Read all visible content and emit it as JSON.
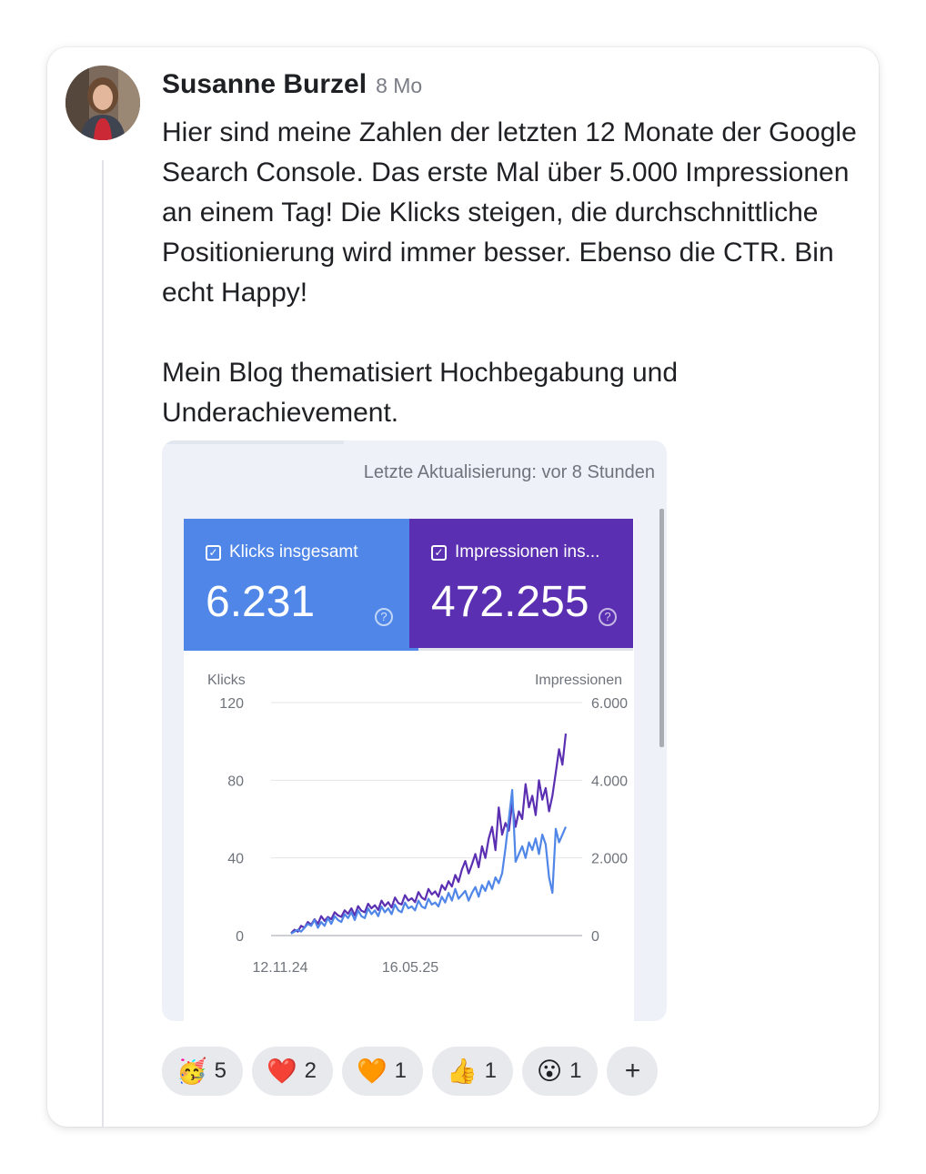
{
  "post": {
    "author": "Susanne Burzel",
    "time": "8 Mo",
    "paragraphs": [
      "Hier sind meine Zahlen der letzten 12 Monate der Google Search Console. Das erste Mal über 5.000 Impressionen an einem Tag! Die Klicks steigen, die durchschnittliche Positionierung wird immer besser. Ebenso die CTR. Bin echt Happy!",
      "Mein Blog thematisiert Hochbegabung und Underachievement."
    ]
  },
  "screenshot": {
    "updated": "Letzte Aktualisierung: vor 8 Stunden",
    "metrics": {
      "klicks": {
        "label": "Klicks insgesamt",
        "value": "6.231",
        "color": "#4f86e7"
      },
      "impressionen": {
        "label": "Impressionen ins...",
        "value": "472.255",
        "color": "#5b2fb1"
      }
    },
    "help_glyph": "?",
    "check_glyph": "✓"
  },
  "chart_data": {
    "type": "line",
    "left_axis_title": "Klicks",
    "right_axis_title": "Impressionen",
    "left_ticks": [
      "0",
      "40",
      "80",
      "120"
    ],
    "right_ticks": [
      "0",
      "2.000",
      "4.000",
      "6.000"
    ],
    "x_tick_labels": [
      "12.11.24",
      "16.05.25"
    ],
    "ylim_left": [
      0,
      120
    ],
    "ylim_right": [
      0,
      6000
    ],
    "grid": true,
    "series": [
      {
        "name": "Klicks",
        "axis": "left",
        "color": "#4f86e7",
        "values": [
          1,
          2,
          3,
          2,
          4,
          6,
          5,
          8,
          4,
          7,
          5,
          9,
          6,
          10,
          8,
          7,
          11,
          9,
          12,
          8,
          13,
          10,
          9,
          14,
          11,
          13,
          10,
          15,
          12,
          14,
          11,
          16,
          13,
          12,
          17,
          14,
          15,
          13,
          18,
          15,
          14,
          19,
          16,
          17,
          15,
          20,
          17,
          22,
          18,
          24,
          19,
          21,
          23,
          18,
          22,
          25,
          20,
          26,
          23,
          28,
          24,
          30,
          27,
          32,
          45,
          60,
          75,
          38,
          42,
          46,
          40,
          48,
          44,
          50,
          42,
          52,
          47,
          30,
          22,
          55,
          48,
          52,
          56
        ]
      },
      {
        "name": "Impressionen",
        "axis": "right",
        "color": "#5b2fb1",
        "values": [
          60,
          150,
          100,
          250,
          200,
          350,
          280,
          420,
          300,
          500,
          380,
          480,
          420,
          600,
          520,
          480,
          650,
          560,
          700,
          520,
          760,
          640,
          600,
          820,
          700,
          780,
          660,
          900,
          760,
          860,
          720,
          980,
          840,
          800,
          1040,
          900,
          960,
          860,
          1120,
          980,
          920,
          1200,
          1060,
          1140,
          1000,
          1300,
          1180,
          1400,
          1260,
          1560,
          1380,
          1700,
          1920,
          1600,
          1840,
          2100,
          1760,
          2300,
          2000,
          2500,
          2800,
          2200,
          3300,
          2600,
          2900,
          2700,
          3400,
          2800,
          3200,
          3000,
          3900,
          3300,
          3600,
          3100,
          4000,
          3500,
          3800,
          3200,
          3600,
          4200,
          4800,
          4400,
          5200
        ]
      }
    ]
  },
  "reactions": [
    {
      "emoji": "🥳",
      "count": "5"
    },
    {
      "emoji": "❤️",
      "count": "2"
    },
    {
      "emoji": "🧡",
      "count": "1"
    },
    {
      "emoji": "👍",
      "count": "1"
    },
    {
      "emoji": "😮",
      "count": "1"
    }
  ],
  "add_reaction_label": "+"
}
